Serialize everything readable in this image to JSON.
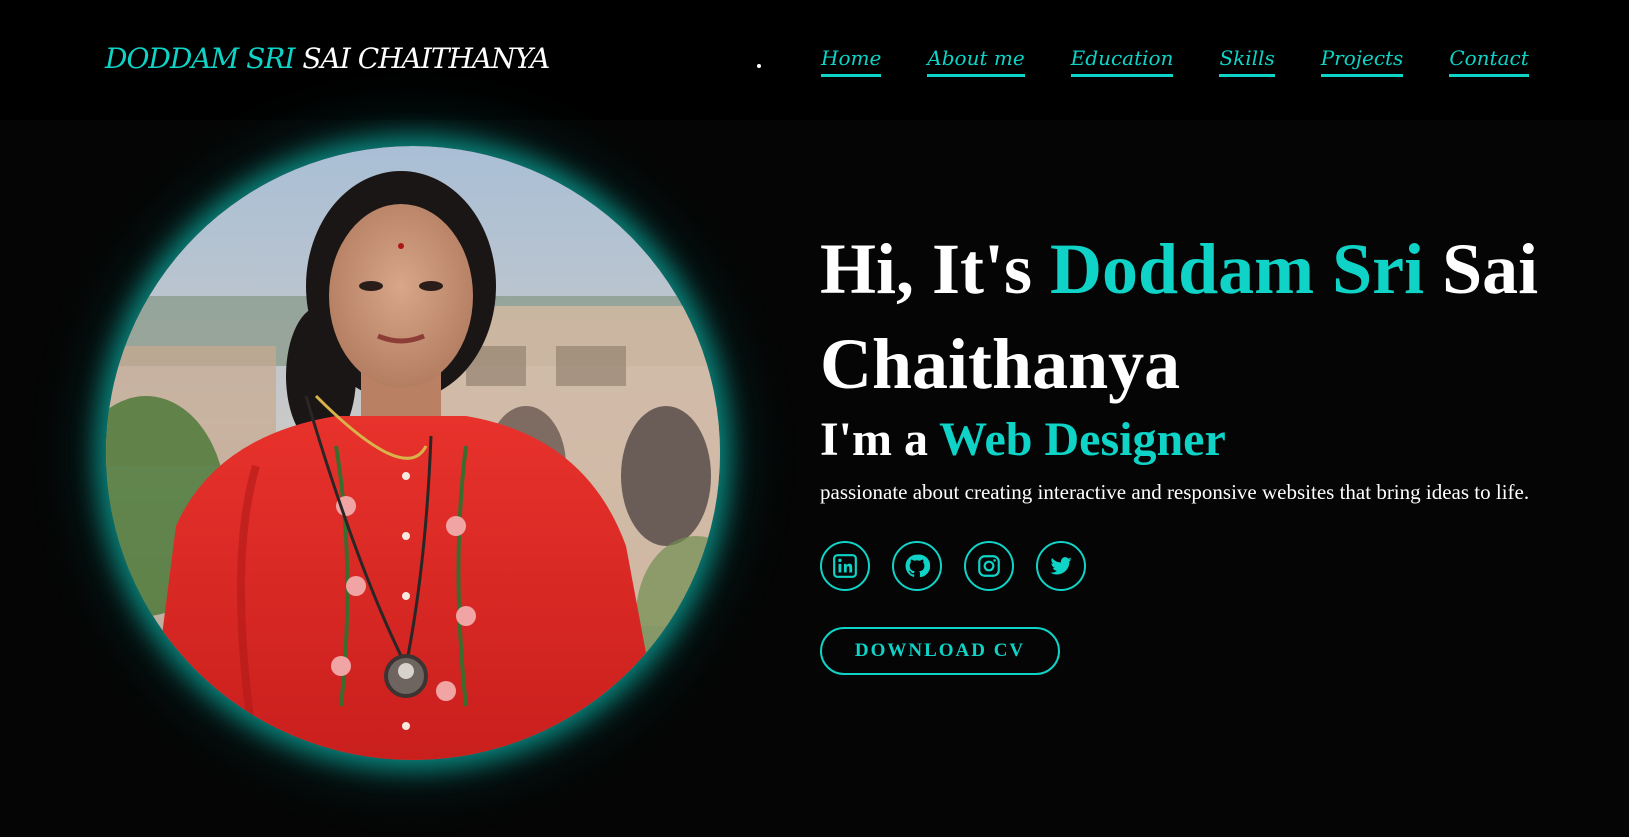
{
  "header": {
    "logo_first": "DODDAM SRI",
    "logo_second": "SAI CHAITHANYA",
    "nav": [
      "Home",
      "About me",
      "Education",
      "Skills",
      "Projects",
      "Contact"
    ]
  },
  "hero": {
    "greeting": "Hi, It's",
    "name_accent": "Doddam Sri",
    "name_rest": "Sai Chaithanya",
    "role_prefix": "I'm a",
    "role": "Web Designer",
    "tagline": "passionate about creating interactive and responsive websites that bring ideas to life.",
    "socials": [
      "linkedin-icon",
      "github-icon",
      "instagram-icon",
      "twitter-icon"
    ],
    "cv_label": "DOWNLOAD CV"
  },
  "colors": {
    "accent": "#0ed3c6",
    "background": "#050505",
    "text": "#ffffff"
  }
}
